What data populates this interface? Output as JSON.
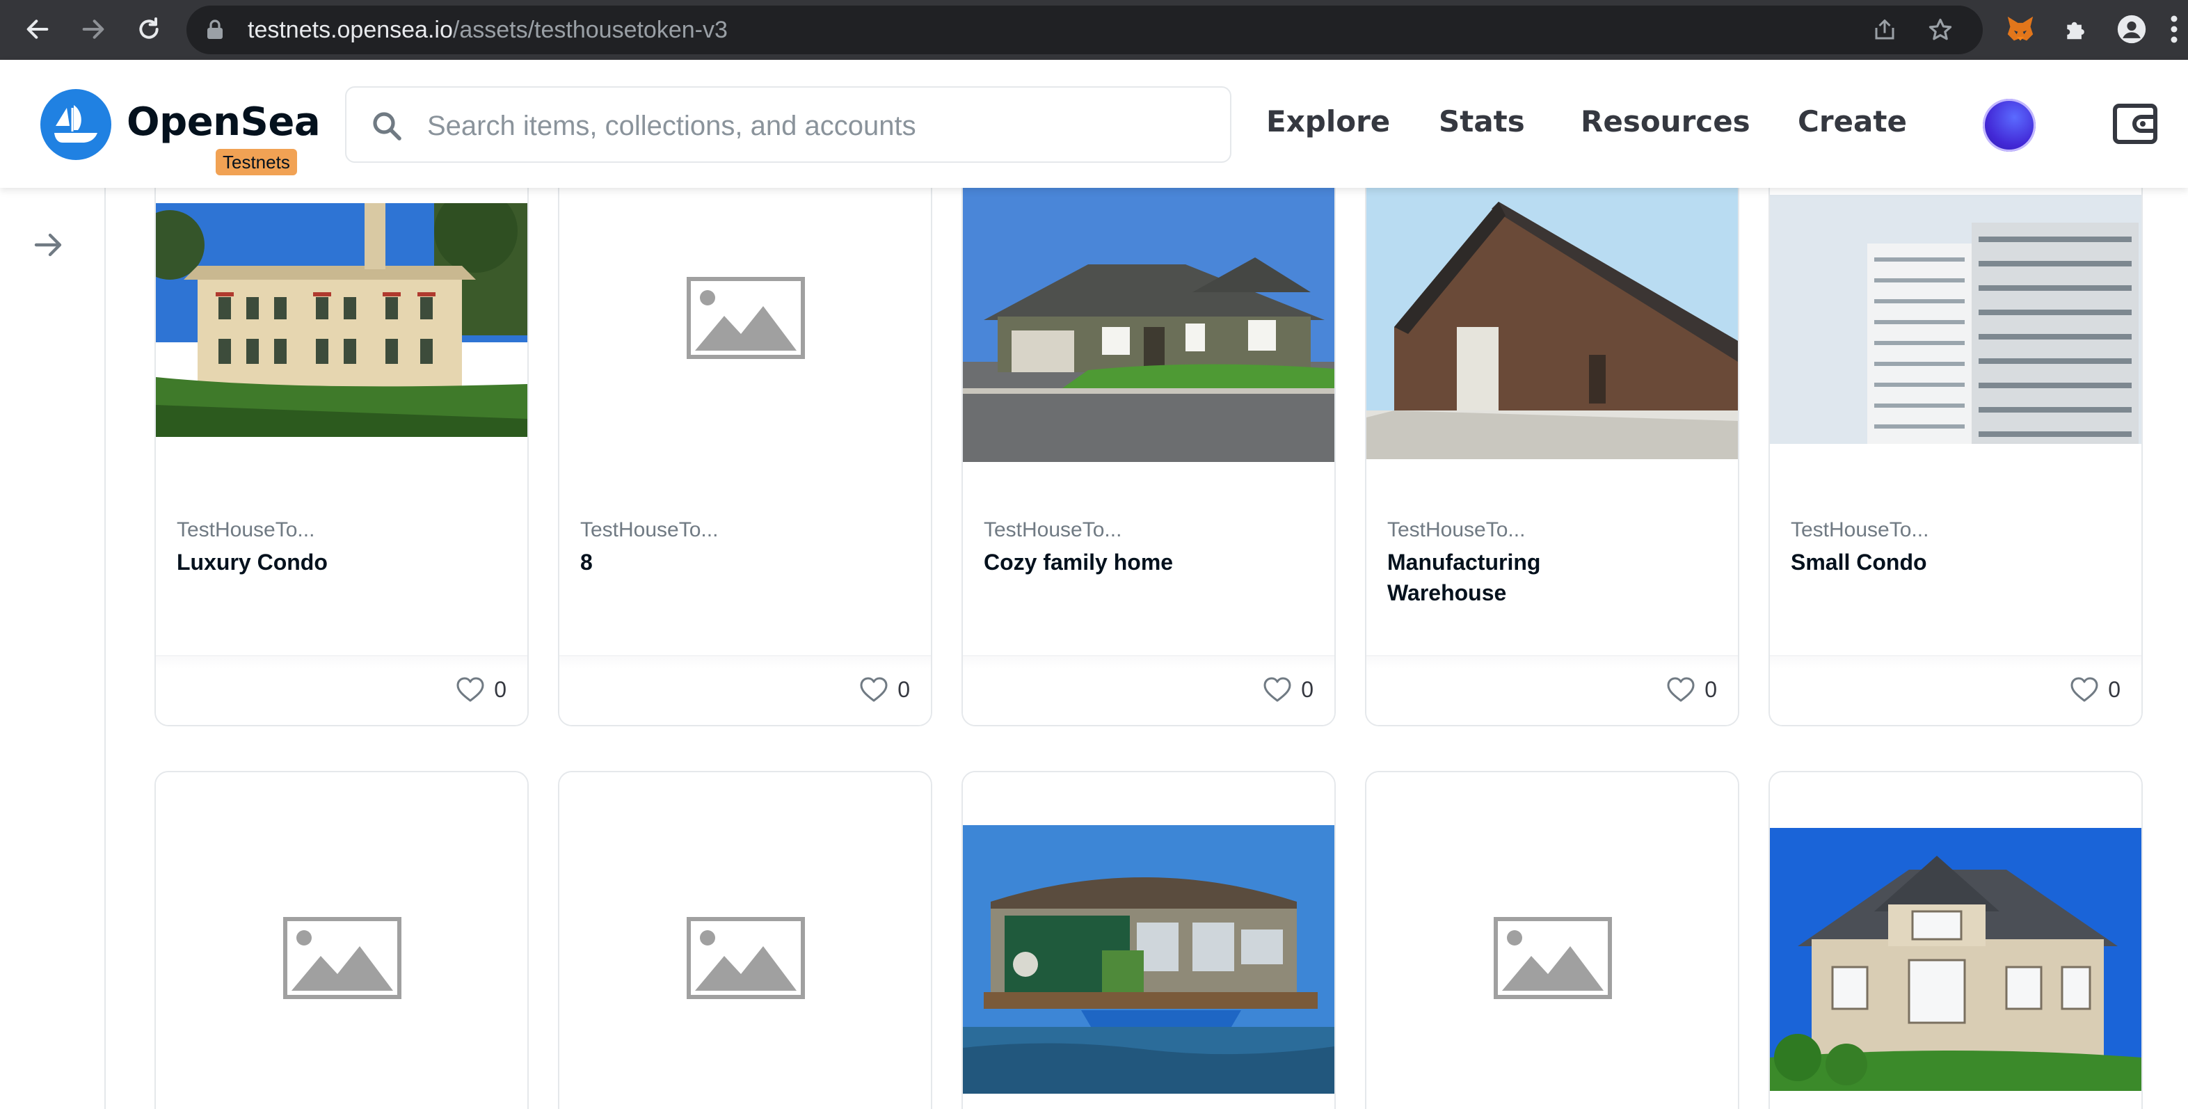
{
  "browser": {
    "url_host": "testnets.opensea.io",
    "url_path": "/assets/testhousetoken-v3"
  },
  "header": {
    "brand": "OpenSea",
    "badge": "Testnets",
    "search_placeholder": "Search items, collections, and accounts",
    "nav": [
      "Explore",
      "Stats",
      "Resources",
      "Create"
    ]
  },
  "colors": {
    "brand_blue": "#2081e2",
    "badge_orange": "#f1a254",
    "text_dark": "#04111d",
    "text_muted": "#707a83",
    "border": "#e5e8eb"
  },
  "cards_row1": [
    {
      "collection": "TestHouseTo...",
      "name": "Luxury Condo",
      "likes": "0",
      "image": "mansion-photo"
    },
    {
      "collection": "TestHouseTo...",
      "name": "8",
      "likes": "0",
      "image": "image-placeholder-icon"
    },
    {
      "collection": "TestHouseTo...",
      "name": "Cozy family home",
      "likes": "0",
      "image": "suburban-house-photo"
    },
    {
      "collection": "TestHouseTo...",
      "name": "Manufacturing Warehouse",
      "likes": "0",
      "image": "barn-warehouse-photo"
    },
    {
      "collection": "TestHouseTo...",
      "name": "Small Condo",
      "likes": "0",
      "image": "apartment-tower-photo"
    }
  ],
  "cards_row2": [
    {
      "image": "image-placeholder-icon"
    },
    {
      "image": "image-placeholder-icon"
    },
    {
      "image": "houseboat-photo"
    },
    {
      "image": "image-placeholder-icon"
    },
    {
      "image": "large-house-photo"
    }
  ]
}
